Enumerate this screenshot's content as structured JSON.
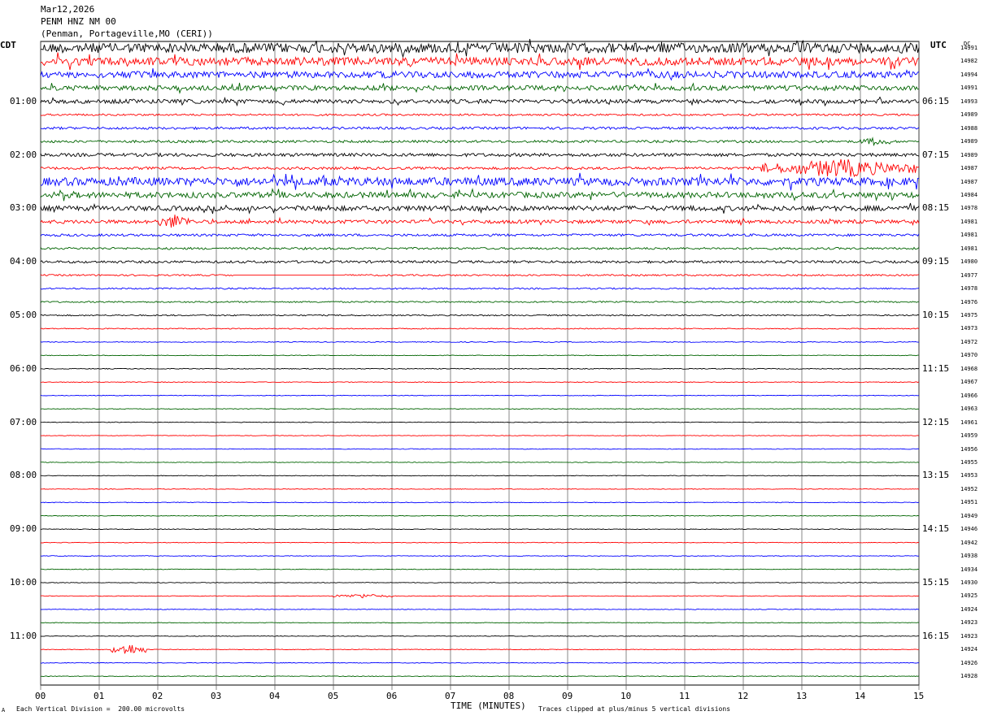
{
  "header": {
    "date": "Mar12,2026",
    "station": "PENM HNZ NM 00",
    "location": "(Penman, Portageville,MO (CERI))"
  },
  "left_label": "CDT",
  "right_label": "UTC",
  "dc_label": "DC",
  "footer": {
    "scale_note": "Each Vertical Division =  200.00 microvolts",
    "clip_note": "Traces clipped at plus/minus 5 vertical divisions",
    "mark": "A"
  },
  "colors": {
    "palette": [
      "#000000",
      "#ff0000",
      "#0000ff",
      "#006400"
    ],
    "grid": "#000000"
  },
  "chart_data": {
    "type": "line",
    "title": "",
    "xlabel": "TIME (MINUTES)",
    "x_ticks": [
      "00",
      "01",
      "02",
      "03",
      "04",
      "05",
      "06",
      "07",
      "08",
      "09",
      "10",
      "11",
      "12",
      "13",
      "14",
      "15"
    ],
    "xlim": [
      0,
      15
    ],
    "left_ticks": [
      "01:00",
      "02:00",
      "03:00",
      "04:00",
      "05:00",
      "06:00",
      "07:00",
      "08:00",
      "09:00",
      "10:00",
      "11:00"
    ],
    "right_ticks": [
      "06:15",
      "07:15",
      "08:15",
      "09:15",
      "10:15",
      "11:15",
      "12:15",
      "13:15",
      "14:15",
      "15:15",
      "16:15"
    ],
    "dc_offsets": [
      14991,
      14982,
      14994,
      14991,
      14993,
      14989,
      14988,
      14989,
      14989,
      14987,
      14987,
      14984,
      14978,
      14981,
      14981,
      14981,
      14980,
      14977,
      14978,
      14976,
      14975,
      14973,
      14972,
      14970,
      14968,
      14967,
      14966,
      14963,
      14961,
      14959,
      14956,
      14955,
      14953,
      14952,
      14951,
      14949,
      14946,
      14942,
      14938,
      14934,
      14930,
      14925,
      14924,
      14923,
      14923,
      14924,
      14926,
      14928
    ],
    "trace_activity": [
      6,
      5,
      4,
      3,
      2.5,
      1.2,
      1.5,
      1.5,
      2,
      1.6,
      5,
      3.5,
      3,
      2.2,
      1.5,
      1.3,
      1.5,
      1,
      0.9,
      0.9,
      0.8,
      0.6,
      0.5,
      0.4,
      0.5,
      0.5,
      0.4,
      0.4,
      0.4,
      0.4,
      0.4,
      0.4,
      0.4,
      0.4,
      0.4,
      0.4,
      0.4,
      0.4,
      0.4,
      0.4,
      0.4,
      0.4,
      0.4,
      0.4,
      0.4,
      0.4,
      0.4,
      0.4
    ],
    "events": [
      {
        "trace": 9,
        "start": 12.3,
        "end": 15,
        "amp": 11
      },
      {
        "trace": 17,
        "start": 3.3,
        "end": 5.2,
        "amp": 0,
        "flat": true
      },
      {
        "trace": 45,
        "start": 1.2,
        "end": 1.8,
        "amp": 8
      },
      {
        "trace": 13,
        "start": 2.0,
        "end": 2.6,
        "amp": 8
      },
      {
        "trace": 41,
        "start": 5.0,
        "end": 6.0,
        "amp": 2.5
      },
      {
        "trace": 7,
        "start": 14.0,
        "end": 14.5,
        "amp": 4
      }
    ]
  }
}
